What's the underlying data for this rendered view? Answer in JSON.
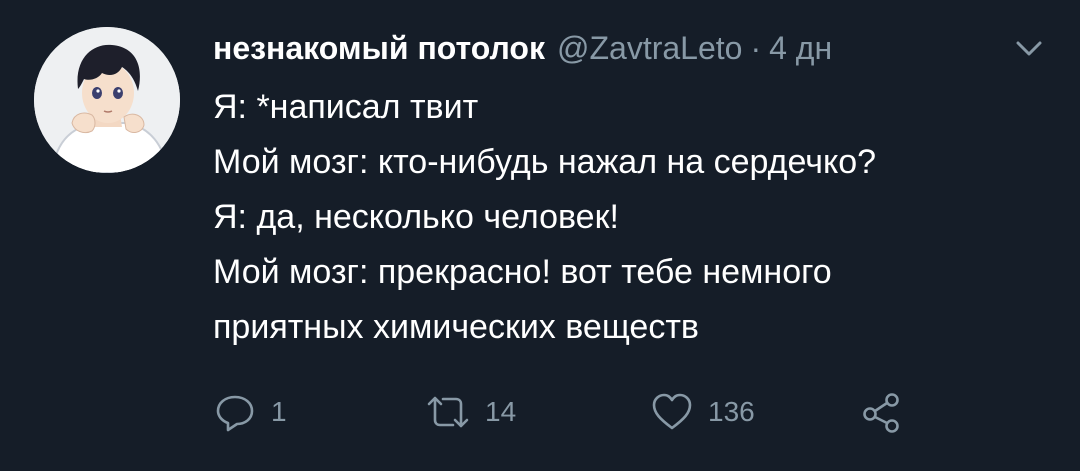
{
  "tweet": {
    "author_name": "незнакомый потолок",
    "handle": "@ZavtraLeto",
    "separator": "·",
    "time": "4 дн",
    "lines": [
      "Я: *написал твит",
      "Мой мозг: кто-нибудь нажал на сердечко?",
      "Я: да, несколько человек!",
      "Мой мозг: прекрасно! вот тебе немного",
      "приятных химических веществ"
    ]
  },
  "actions": {
    "reply": {
      "icon": "reply-icon",
      "count": "1"
    },
    "retweet": {
      "icon": "retweet-icon",
      "count": "14"
    },
    "like": {
      "icon": "heart-icon",
      "count": "136"
    },
    "share": {
      "icon": "share-icon"
    }
  },
  "colors": {
    "background": "#151d28",
    "text": "#ffffff",
    "muted": "#8899a6"
  }
}
